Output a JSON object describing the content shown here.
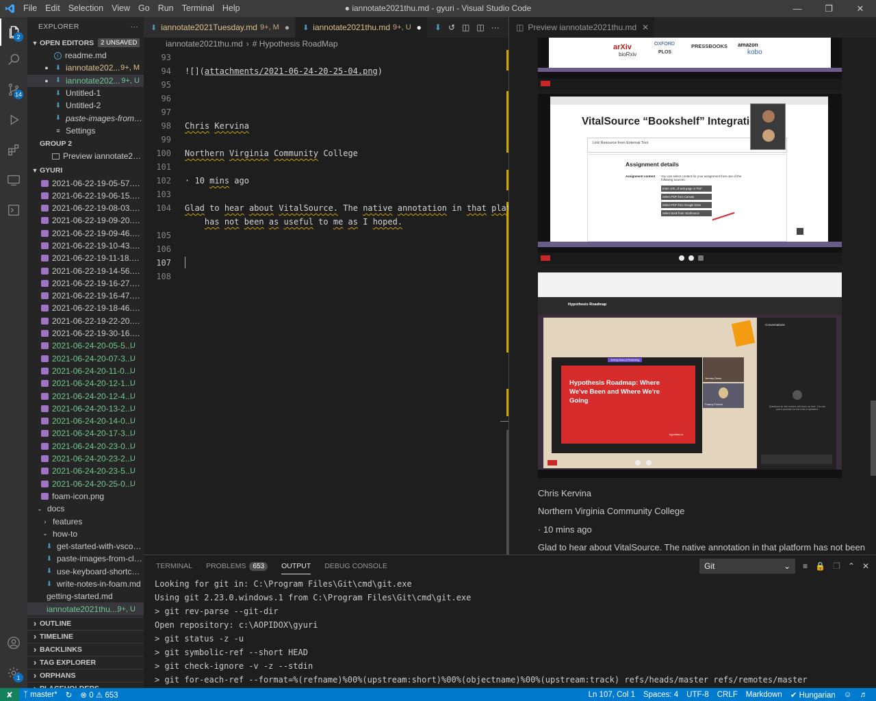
{
  "window": {
    "title": "● iannotate2021thu.md - gyuri - Visual Studio Code",
    "menu": [
      "File",
      "Edit",
      "Selection",
      "View",
      "Go",
      "Run",
      "Terminal",
      "Help"
    ]
  },
  "activity": {
    "explorer_badge": "2",
    "scm_badge": "14",
    "settings_badge": "1"
  },
  "sidebar": {
    "header": "EXPLORER",
    "open_editors_title": "OPEN EDITORS",
    "unsaved_badge": "2 UNSAVED",
    "open_editors": [
      {
        "label": "readme.md",
        "status": "",
        "icon": "info-icon",
        "dirty": false
      },
      {
        "label": "iannotate202...",
        "status": "9+, M",
        "icon": "markdown-icon",
        "dirty": true
      },
      {
        "label": "iannotate202...",
        "status": "9+, U",
        "icon": "markdown-icon",
        "dirty": true
      },
      {
        "label": "Untitled-1",
        "status": "",
        "icon": "markdown-icon",
        "dirty": false
      },
      {
        "label": "Untitled-2",
        "status": "",
        "icon": "markdown-icon",
        "dirty": false
      },
      {
        "label": "paste-images-from-cli...",
        "status": "",
        "icon": "markdown-icon",
        "dirty": false
      },
      {
        "label": "Settings",
        "status": "",
        "icon": "settings-icon",
        "dirty": false
      }
    ],
    "group2_title": "GROUP 2",
    "group2_item": "Preview iannotate2021...",
    "workspace_title": "GYURI",
    "files": [
      {
        "label": "2021-06-22-19-05-57.png",
        "status": ""
      },
      {
        "label": "2021-06-22-19-06-15.png",
        "status": ""
      },
      {
        "label": "2021-06-22-19-08-03.png",
        "status": ""
      },
      {
        "label": "2021-06-22-19-09-20.png",
        "status": ""
      },
      {
        "label": "2021-06-22-19-09-46.png",
        "status": ""
      },
      {
        "label": "2021-06-22-19-10-43.png",
        "status": ""
      },
      {
        "label": "2021-06-22-19-11-18.png",
        "status": ""
      },
      {
        "label": "2021-06-22-19-14-56.png",
        "status": ""
      },
      {
        "label": "2021-06-22-19-16-27.png",
        "status": ""
      },
      {
        "label": "2021-06-22-19-16-47.png",
        "status": ""
      },
      {
        "label": "2021-06-22-19-18-46.png",
        "status": ""
      },
      {
        "label": "2021-06-22-19-22-20.png",
        "status": ""
      },
      {
        "label": "2021-06-22-19-30-16.png",
        "status": ""
      },
      {
        "label": "2021-06-24-20-05-5...",
        "status": "U"
      },
      {
        "label": "2021-06-24-20-07-3...",
        "status": "U"
      },
      {
        "label": "2021-06-24-20-11-0...",
        "status": "U"
      },
      {
        "label": "2021-06-24-20-12-1...",
        "status": "U"
      },
      {
        "label": "2021-06-24-20-12-4...",
        "status": "U"
      },
      {
        "label": "2021-06-24-20-13-2...",
        "status": "U"
      },
      {
        "label": "2021-06-24-20-14-0...",
        "status": "U"
      },
      {
        "label": "2021-06-24-20-17-3...",
        "status": "U"
      },
      {
        "label": "2021-06-24-20-23-0...",
        "status": "U"
      },
      {
        "label": "2021-06-24-20-23-2...",
        "status": "U"
      },
      {
        "label": "2021-06-24-20-23-5...",
        "status": "U"
      },
      {
        "label": "2021-06-24-20-25-0...",
        "status": "U"
      }
    ],
    "foam_icon": "foam-icon.png",
    "docs_folder": "docs",
    "features_folder": "features",
    "howto_folder": "how-to",
    "howto_files": [
      "get-started-with-vscode....",
      "paste-images-from-clipb...",
      "use-keyboard-shortcuts-...",
      "write-notes-in-foam.md"
    ],
    "getting_started": "getting-started.md",
    "current_file": {
      "label": "iannotate2021thu....",
      "status": "9+, U"
    },
    "sections": [
      "OUTLINE",
      "TIMELINE",
      "BACKLINKS",
      "TAG EXPLORER",
      "ORPHANS",
      "PLACEHOLDERS"
    ]
  },
  "editor": {
    "tabs": [
      {
        "label": "iannotate2021Tuesday.md",
        "status": "9+, M"
      },
      {
        "label": "iannotate2021thu.md",
        "status": "9+, U"
      }
    ],
    "breadcrumb": [
      "iannotate2021thu.md",
      "# Hypothesis RoadMap"
    ],
    "lines": [
      {
        "n": "93",
        "text": ""
      },
      {
        "n": "94",
        "text": "![](attachments/2021-06-24-20-25-04.png)"
      },
      {
        "n": "95",
        "text": ""
      },
      {
        "n": "96",
        "text": ""
      },
      {
        "n": "97",
        "text": ""
      },
      {
        "n": "98",
        "text": "Chris Kervina"
      },
      {
        "n": "99",
        "text": ""
      },
      {
        "n": "100",
        "text": "Northern Virginia Community College"
      },
      {
        "n": "101",
        "text": ""
      },
      {
        "n": "102",
        "text": "· 10 mins ago"
      },
      {
        "n": "103",
        "text": ""
      },
      {
        "n": "104",
        "text": "Glad to hear about VitalSource. The native annotation in that platform"
      },
      {
        "n": "",
        "text": "    has not been as useful to me as I hoped."
      },
      {
        "n": "105",
        "text": ""
      },
      {
        "n": "106",
        "text": ""
      },
      {
        "n": "107",
        "text": ""
      },
      {
        "n": "108",
        "text": ""
      }
    ]
  },
  "preview": {
    "tab": "Preview iannotate2021thu.md",
    "shot1": {
      "logos": [
        "arXiv",
        "bioRxiv",
        "OXFORD",
        "PLOS",
        "PRESSBOOKS",
        "amazon",
        "kobo"
      ]
    },
    "shot2": {
      "heading": "VitalSource “Bookshelf” Integration",
      "link_label": "Link Resource from External Tool",
      "section": "Assignment details",
      "field_label": "Assignment content",
      "field_hint": "You can select content for your assignment from one of the following sources:",
      "buttons": [
        "Enter URL of web page or PDF",
        "Select PDF from Canvas",
        "Select PDF from Google Drive",
        "Select book from VitalSource"
      ]
    },
    "shot3": {
      "header": "Hypothesis Roadmap",
      "slide_title": "Hypothesis Roadmap: Where We've Been and Where We're Going",
      "slide_footer": "hypothes.is",
      "speakers": [
        "Jeremy Dean",
        "Franny French"
      ],
      "side_tab": "Conversations",
      "empty_msg": "Questions for this session will show up here. You can post a question for the host or speakers."
    },
    "text_author": "Chris Kervina",
    "text_org": "Northern Virginia Community College",
    "text_time": "· 10 mins ago",
    "text_body": "Glad to hear about VitalSource. The native annotation in that platform has not been"
  },
  "panel": {
    "tabs": [
      "TERMINAL",
      "PROBLEMS",
      "OUTPUT",
      "DEBUG CONSOLE"
    ],
    "problems_count": "653",
    "channel": "Git",
    "output": [
      "Looking for git in: C:\\Program Files\\Git\\cmd\\git.exe",
      "Using git 2.23.0.windows.1 from C:\\Program Files\\Git\\cmd\\git.exe",
      "> git rev-parse --git-dir",
      "Open repository: c:\\AOPIDOX\\gyuri",
      "> git status -z -u",
      "> git symbolic-ref --short HEAD",
      "> git check-ignore -v -z --stdin",
      "> git for-each-ref --format=%(refname)%00%(upstream:short)%00%(objectname)%00%(upstream:track) refs/heads/master refs/remotes/master"
    ]
  },
  "statusbar": {
    "branch": "master*",
    "errors": "0",
    "warnings": "653",
    "position": "Ln 107, Col 1",
    "spaces": "Spaces: 4",
    "encoding": "UTF-8",
    "eol": "CRLF",
    "language": "Markdown",
    "spell": "Hungarian"
  },
  "colors": {
    "modified": "#e2c08d",
    "untracked": "#73c991",
    "statusbar": "#007acc",
    "accent": "#0e70c0"
  }
}
